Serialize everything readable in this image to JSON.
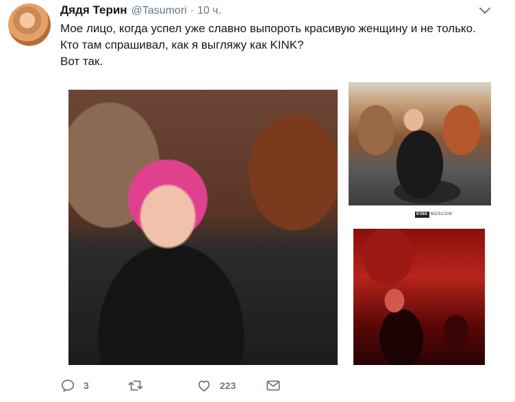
{
  "tweet": {
    "author_name": "Дядя Терин",
    "author_handle": "@Tasumori",
    "separator": "·",
    "time": "10 ч.",
    "text_lines": [
      "Мое лицо, когда успел уже славно выпороть красивую женщину и не только.",
      "Кто там спрашивал, как я выгляжу как KINK?",
      "Вот так."
    ],
    "photo_caption_brand": "KINK",
    "photo_caption_city": "MOSCOW"
  },
  "actions": {
    "reply_count": "3",
    "retweet_count": "",
    "like_count": "223"
  },
  "icons": {
    "menu": "chevron-down-icon",
    "reply": "reply-icon",
    "retweet": "retweet-icon",
    "like": "heart-icon",
    "dm": "envelope-icon"
  },
  "colors": {
    "text": "#14171a",
    "muted": "#657786",
    "icon": "#657786"
  }
}
